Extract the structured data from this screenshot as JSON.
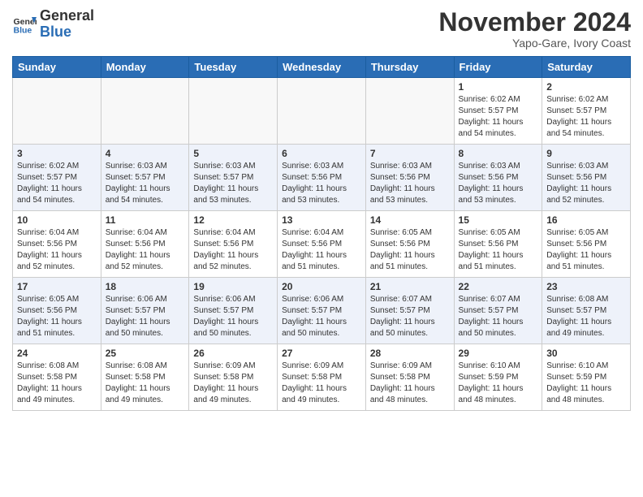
{
  "header": {
    "logo_general": "General",
    "logo_blue": "Blue",
    "month_title": "November 2024",
    "location": "Yapo-Gare, Ivory Coast"
  },
  "weekdays": [
    "Sunday",
    "Monday",
    "Tuesday",
    "Wednesday",
    "Thursday",
    "Friday",
    "Saturday"
  ],
  "weeks": [
    [
      {
        "day": "",
        "empty": true
      },
      {
        "day": "",
        "empty": true
      },
      {
        "day": "",
        "empty": true
      },
      {
        "day": "",
        "empty": true
      },
      {
        "day": "",
        "empty": true
      },
      {
        "day": "1",
        "sunrise": "6:02 AM",
        "sunset": "5:57 PM",
        "daylight": "11 hours and 54 minutes."
      },
      {
        "day": "2",
        "sunrise": "6:02 AM",
        "sunset": "5:57 PM",
        "daylight": "11 hours and 54 minutes."
      }
    ],
    [
      {
        "day": "3",
        "sunrise": "6:02 AM",
        "sunset": "5:57 PM",
        "daylight": "11 hours and 54 minutes."
      },
      {
        "day": "4",
        "sunrise": "6:03 AM",
        "sunset": "5:57 PM",
        "daylight": "11 hours and 54 minutes."
      },
      {
        "day": "5",
        "sunrise": "6:03 AM",
        "sunset": "5:57 PM",
        "daylight": "11 hours and 53 minutes."
      },
      {
        "day": "6",
        "sunrise": "6:03 AM",
        "sunset": "5:56 PM",
        "daylight": "11 hours and 53 minutes."
      },
      {
        "day": "7",
        "sunrise": "6:03 AM",
        "sunset": "5:56 PM",
        "daylight": "11 hours and 53 minutes."
      },
      {
        "day": "8",
        "sunrise": "6:03 AM",
        "sunset": "5:56 PM",
        "daylight": "11 hours and 53 minutes."
      },
      {
        "day": "9",
        "sunrise": "6:03 AM",
        "sunset": "5:56 PM",
        "daylight": "11 hours and 52 minutes."
      }
    ],
    [
      {
        "day": "10",
        "sunrise": "6:04 AM",
        "sunset": "5:56 PM",
        "daylight": "11 hours and 52 minutes."
      },
      {
        "day": "11",
        "sunrise": "6:04 AM",
        "sunset": "5:56 PM",
        "daylight": "11 hours and 52 minutes."
      },
      {
        "day": "12",
        "sunrise": "6:04 AM",
        "sunset": "5:56 PM",
        "daylight": "11 hours and 52 minutes."
      },
      {
        "day": "13",
        "sunrise": "6:04 AM",
        "sunset": "5:56 PM",
        "daylight": "11 hours and 51 minutes."
      },
      {
        "day": "14",
        "sunrise": "6:05 AM",
        "sunset": "5:56 PM",
        "daylight": "11 hours and 51 minutes."
      },
      {
        "day": "15",
        "sunrise": "6:05 AM",
        "sunset": "5:56 PM",
        "daylight": "11 hours and 51 minutes."
      },
      {
        "day": "16",
        "sunrise": "6:05 AM",
        "sunset": "5:56 PM",
        "daylight": "11 hours and 51 minutes."
      }
    ],
    [
      {
        "day": "17",
        "sunrise": "6:05 AM",
        "sunset": "5:56 PM",
        "daylight": "11 hours and 51 minutes."
      },
      {
        "day": "18",
        "sunrise": "6:06 AM",
        "sunset": "5:57 PM",
        "daylight": "11 hours and 50 minutes."
      },
      {
        "day": "19",
        "sunrise": "6:06 AM",
        "sunset": "5:57 PM",
        "daylight": "11 hours and 50 minutes."
      },
      {
        "day": "20",
        "sunrise": "6:06 AM",
        "sunset": "5:57 PM",
        "daylight": "11 hours and 50 minutes."
      },
      {
        "day": "21",
        "sunrise": "6:07 AM",
        "sunset": "5:57 PM",
        "daylight": "11 hours and 50 minutes."
      },
      {
        "day": "22",
        "sunrise": "6:07 AM",
        "sunset": "5:57 PM",
        "daylight": "11 hours and 50 minutes."
      },
      {
        "day": "23",
        "sunrise": "6:08 AM",
        "sunset": "5:57 PM",
        "daylight": "11 hours and 49 minutes."
      }
    ],
    [
      {
        "day": "24",
        "sunrise": "6:08 AM",
        "sunset": "5:58 PM",
        "daylight": "11 hours and 49 minutes."
      },
      {
        "day": "25",
        "sunrise": "6:08 AM",
        "sunset": "5:58 PM",
        "daylight": "11 hours and 49 minutes."
      },
      {
        "day": "26",
        "sunrise": "6:09 AM",
        "sunset": "5:58 PM",
        "daylight": "11 hours and 49 minutes."
      },
      {
        "day": "27",
        "sunrise": "6:09 AM",
        "sunset": "5:58 PM",
        "daylight": "11 hours and 49 minutes."
      },
      {
        "day": "28",
        "sunrise": "6:09 AM",
        "sunset": "5:58 PM",
        "daylight": "11 hours and 48 minutes."
      },
      {
        "day": "29",
        "sunrise": "6:10 AM",
        "sunset": "5:59 PM",
        "daylight": "11 hours and 48 minutes."
      },
      {
        "day": "30",
        "sunrise": "6:10 AM",
        "sunset": "5:59 PM",
        "daylight": "11 hours and 48 minutes."
      }
    ]
  ]
}
